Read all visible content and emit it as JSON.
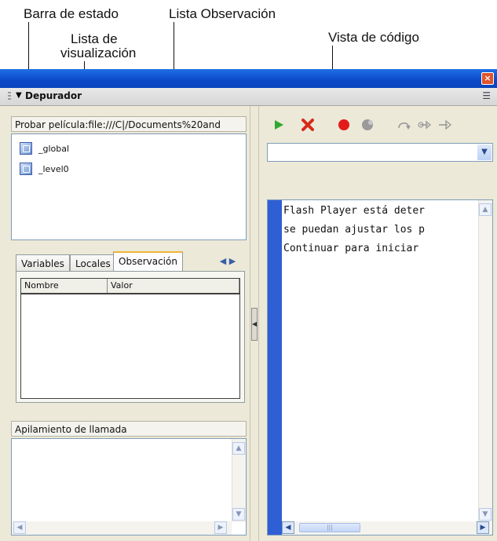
{
  "annotations": {
    "status_bar": "Barra de estado",
    "watch_list": "Lista Observación",
    "display_list_line1": "Lista de",
    "display_list_line2": "visualización",
    "code_view": "Vista de código"
  },
  "window": {
    "close_glyph": "×"
  },
  "panel": {
    "title": "Depurador",
    "collapse_glyph": "▼",
    "menu_glyph": "☰"
  },
  "status_bar": {
    "text": "Probar película:file:///C|/Documents%20and"
  },
  "display_list": {
    "items": [
      "_global",
      "_level0"
    ]
  },
  "tabs": {
    "items": [
      "Variables",
      "Locales",
      "Observación"
    ],
    "active": "Observación",
    "arrows": "◀ ▶"
  },
  "watch_table": {
    "columns": [
      "Nombre",
      "Valor"
    ]
  },
  "call_stack": {
    "title": "Apilamiento de llamada"
  },
  "toolbar": {
    "icons": [
      "continue-icon",
      "stop-debugging-icon",
      "breakpoint-icon",
      "remove-breakpoints-icon",
      "step-over-icon",
      "step-in-icon",
      "step-out-icon"
    ],
    "colors": {
      "continue": "#2faa2f",
      "stop": "#d72a1a",
      "breakpoint": "#e31b1b",
      "disabled": "#9a9a9a",
      "gutter": "#2f5fd4"
    }
  },
  "code": {
    "lines": [
      "Flash Player está deter",
      "se puedan ajustar los p",
      "Continuar para iniciar"
    ]
  }
}
